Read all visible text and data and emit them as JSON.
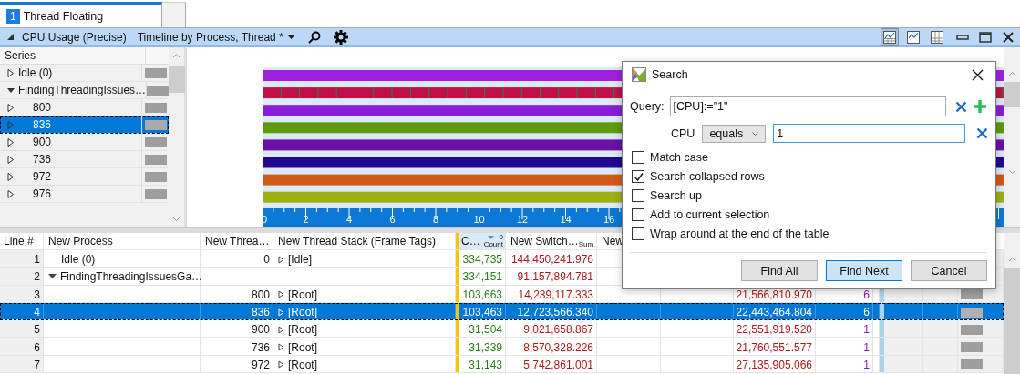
{
  "tab": {
    "number": "1",
    "label": "Thread Floating",
    "selected": true
  },
  "pane": {
    "title": "CPU Usage (Precise)",
    "preset": "Timeline by Process, Thread *",
    "views": [
      {
        "kind": "graph-table",
        "selected": true
      },
      {
        "kind": "graph",
        "selected": false
      },
      {
        "kind": "table",
        "selected": false
      }
    ]
  },
  "series": {
    "header": "Series",
    "items": [
      {
        "label": "Idle (0)",
        "expanded": false,
        "selected": false
      },
      {
        "label": "FindingThreadingIssues…",
        "expanded": true,
        "selected": false,
        "children": [
          {
            "label": "800",
            "expanded": false,
            "selected": false
          },
          {
            "label": "836",
            "expanded": false,
            "selected": true
          },
          {
            "label": "900",
            "expanded": false,
            "selected": false
          },
          {
            "label": "736",
            "expanded": false,
            "selected": false
          },
          {
            "label": "972",
            "expanded": false,
            "selected": false
          },
          {
            "label": "976",
            "expanded": false,
            "selected": false
          }
        ]
      }
    ]
  },
  "timeline": {
    "axis_labels": [
      "0",
      "2",
      "4",
      "6",
      "8",
      "10",
      "12",
      "14",
      "16"
    ]
  },
  "table": {
    "columns": [
      {
        "label": "Line #"
      },
      {
        "label": "New Process"
      },
      {
        "label": "New Threa…"
      },
      {
        "label": "New Thread Stack (Frame Tags)"
      },
      {
        "label": "C…",
        "sub": "Count",
        "sort_rank": "0"
      },
      {
        "label": "New Switch…",
        "sub": "Sum"
      },
      {
        "label": "New"
      }
    ],
    "rows": [
      {
        "line": "1",
        "process": "Idle (0)",
        "thread": "0",
        "stack": "[Idle]",
        "count": "334,735",
        "sum": "144,450,241.976",
        "selected": false
      },
      {
        "line": "2",
        "process": "FindingThreadingIssuesGa…",
        "expanded": true,
        "count": "334,151",
        "sum": "91,157,894.781",
        "selected": false,
        "children": [
          {
            "line": "3",
            "thread": "800",
            "stack": "[Root]",
            "count": "103,663",
            "sum": "14,239,117.333",
            "column_9": "21,566,810.970",
            "column_10": "6",
            "selected": false
          },
          {
            "line": "4",
            "thread": "836",
            "stack": "[Root]",
            "count": "103,463",
            "sum": "12,723,566.340",
            "column_9": "22,443,464.804",
            "column_10": "6",
            "selected": true
          },
          {
            "line": "5",
            "thread": "900",
            "stack": "[Root]",
            "count": "31,504",
            "sum": "9,021,658.867",
            "column_9": "22,551,919.520",
            "column_10": "1",
            "selected": false
          },
          {
            "line": "6",
            "thread": "736",
            "stack": "[Root]",
            "count": "31,339",
            "sum": "8,570,328.226",
            "column_9": "21,760,551.577",
            "column_10": "1",
            "selected": false
          },
          {
            "line": "7",
            "thread": "972",
            "stack": "[Root]",
            "count": "31,143",
            "sum": "5,742,861.001",
            "column_9": "27,135,905.066",
            "column_10": "1",
            "selected": false
          }
        ]
      }
    ]
  },
  "dialog": {
    "title": "Search",
    "query_label": "Query:",
    "query": "[CPU]:=\"1\"",
    "field": "CPU",
    "operator": "equals",
    "value": "1",
    "options": [
      {
        "label": "Match case",
        "checked": false
      },
      {
        "label": "Search collapsed rows",
        "checked": true
      },
      {
        "label": "Search up",
        "checked": false
      },
      {
        "label": "Add to current selection",
        "checked": false
      },
      {
        "label": "Wrap around at the end of the table",
        "checked": false
      }
    ],
    "buttons": [
      {
        "label": "Find All",
        "default": false
      },
      {
        "label": "Find Next",
        "default": true
      },
      {
        "label": "Cancel",
        "default": false
      }
    ]
  }
}
